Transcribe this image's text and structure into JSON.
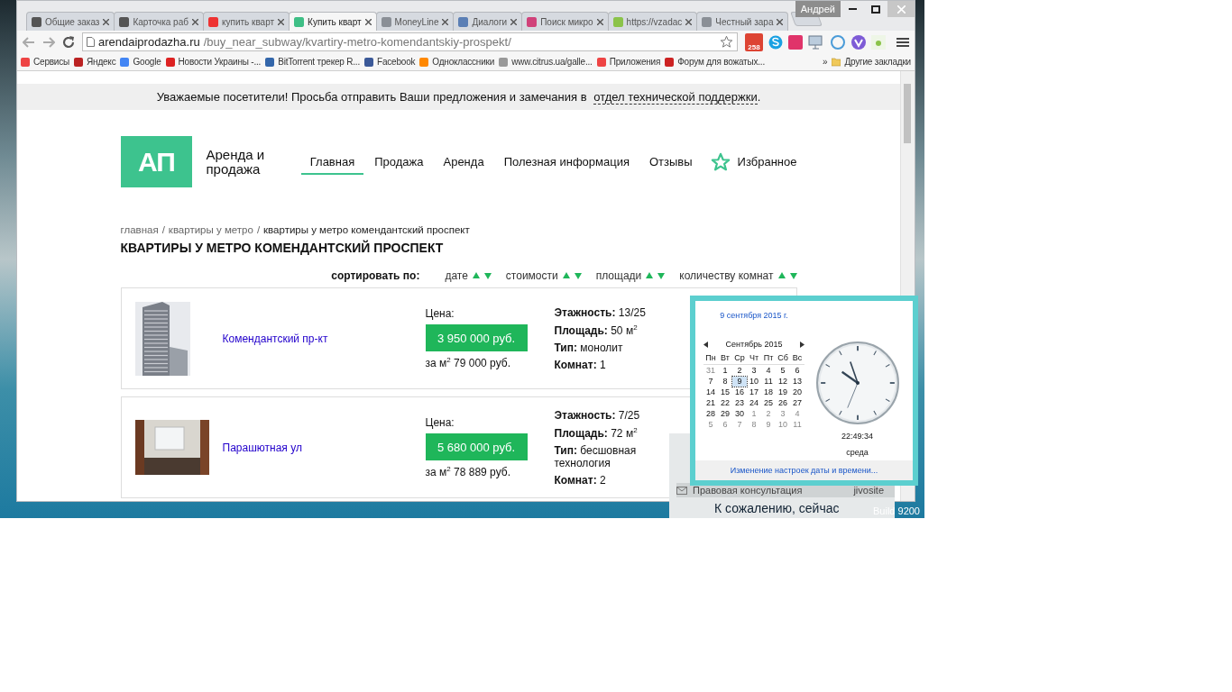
{
  "browser": {
    "tabs": [
      {
        "label": "Общие заказ",
        "selected": false
      },
      {
        "label": "Карточка раб",
        "selected": false
      },
      {
        "label": "купить кварт",
        "selected": false
      },
      {
        "label": "Купить кварт",
        "selected": true
      },
      {
        "label": "MoneyLine",
        "selected": false
      },
      {
        "label": "Диалоги",
        "selected": false
      },
      {
        "label": "Поиск микро",
        "selected": false
      },
      {
        "label": "https://vzadac",
        "selected": false
      },
      {
        "label": "Честный зара",
        "selected": false
      }
    ],
    "profile": "Андрей",
    "address": {
      "host": "arendaiprodazha.ru",
      "path": "/buy_near_subway/kvartiry-metro-komendantskiy-prospekt/"
    },
    "mail_badge": "258",
    "bookmarks": [
      "Сервисы",
      "Яндекс",
      "Google",
      "Новости Украины -...",
      "BitTorrent трекер R...",
      "Facebook",
      "Одноклассники",
      "www.citrus.ua/galle...",
      "Приложения",
      "Форум для вожатых..."
    ],
    "bookmarks_more": "»",
    "other_bookmarks": "Другие закладки"
  },
  "site": {
    "notice": {
      "text": "Уважаемые посетители! Просьба отправить Ваши предложения и замечания в ",
      "link": "отдел технической поддержки",
      "end": "."
    },
    "logo": {
      "mark": "АП",
      "name": "Аренда и продажа"
    },
    "nav": [
      {
        "label": "Главная",
        "selected": true
      },
      {
        "label": "Продажа",
        "selected": false
      },
      {
        "label": "Аренда",
        "selected": false
      },
      {
        "label": "Полезная информация",
        "selected": false
      },
      {
        "label": "Отзывы",
        "selected": false
      }
    ],
    "favorites": "Избранное",
    "breadcrumbs": [
      {
        "kind": "link",
        "text": "главная"
      },
      {
        "kind": "separator",
        "text": "/"
      },
      {
        "kind": "link",
        "text": "квартиры у метро"
      },
      {
        "kind": "separator",
        "text": "/"
      },
      {
        "kind": "current",
        "text": "квартиры у метро комендантский проспект"
      }
    ],
    "title": "КВАРТИРЫ У МЕТРО КОМЕНДАНТСКИЙ ПРОСПЕКТ",
    "sort": {
      "label": "сортировать по:",
      "options": [
        "дате",
        "стоимости",
        "площади",
        "количеству комнат"
      ]
    },
    "listings": [
      {
        "kind": "tower",
        "address": "Комендантский пр-кт",
        "price_label": "Цена:",
        "price": "3 950 000 руб.",
        "per_m2": "за м$^{2}$ 79 000 руб.",
        "details": [
          "**Этажность:** 13/25",
          "**Площадь:** 50 м$^{2}$",
          "**Тип:** монолит",
          "**Комнат:** 1"
        ]
      },
      {
        "kind": "room",
        "address": "Парашютная ул",
        "price_label": "Цена:",
        "price": "5 680 000 руб.",
        "per_m2": "за м$^{2}$ 78 889 руб.",
        "details": [
          "**Этажность:** 7/25",
          "**Площадь:** 72 м$^{2}$",
          "**Тип:** бесшовная технология",
          "**Комнат:** 2"
        ]
      }
    ]
  },
  "chat_widget": {
    "title": "Правовая консультация",
    "brand": "jivosite",
    "message": "К сожалению, сейчас"
  },
  "desktop": {
    "build": "Build 9200"
  },
  "calendar": {
    "date_link": "9 сентября 2015 г.",
    "month": "Сентябрь 2015",
    "weekdays": [
      "Пн",
      "Вт",
      "Ср",
      "Чт",
      "Пт",
      "Сб",
      "Вс"
    ],
    "weeks": [
      [
        {
          "d": "31",
          "other_month": true,
          "selected": false
        },
        {
          "d": "1",
          "other_month": false,
          "selected": false
        },
        {
          "d": "2",
          "other_month": false,
          "selected": false
        },
        {
          "d": "3",
          "other_month": false,
          "selected": false
        },
        {
          "d": "4",
          "other_month": false,
          "selected": false
        },
        {
          "d": "5",
          "other_month": false,
          "selected": false
        },
        {
          "d": "6",
          "other_month": false,
          "selected": false
        }
      ],
      [
        {
          "d": "7",
          "other_month": false,
          "selected": false
        },
        {
          "d": "8",
          "other_month": false,
          "selected": false
        },
        {
          "d": "9",
          "other_month": false,
          "selected": true
        },
        {
          "d": "10",
          "other_month": false,
          "selected": false
        },
        {
          "d": "11",
          "other_month": false,
          "selected": false
        },
        {
          "d": "12",
          "other_month": false,
          "selected": false
        },
        {
          "d": "13",
          "other_month": false,
          "selected": false
        }
      ],
      [
        {
          "d": "14",
          "other_month": false,
          "selected": false
        },
        {
          "d": "15",
          "other_month": false,
          "selected": false
        },
        {
          "d": "16",
          "other_month": false,
          "selected": false
        },
        {
          "d": "17",
          "other_month": false,
          "selected": false
        },
        {
          "d": "18",
          "other_month": false,
          "selected": false
        },
        {
          "d": "19",
          "other_month": false,
          "selected": false
        },
        {
          "d": "20",
          "other_month": false,
          "selected": false
        }
      ],
      [
        {
          "d": "21",
          "other_month": false,
          "selected": false
        },
        {
          "d": "22",
          "other_month": false,
          "selected": false
        },
        {
          "d": "23",
          "other_month": false,
          "selected": false
        },
        {
          "d": "24",
          "other_month": false,
          "selected": false
        },
        {
          "d": "25",
          "other_month": false,
          "selected": false
        },
        {
          "d": "26",
          "other_month": false,
          "selected": false
        },
        {
          "d": "27",
          "other_month": false,
          "selected": false
        }
      ],
      [
        {
          "d": "28",
          "other_month": false,
          "selected": false
        },
        {
          "d": "29",
          "other_month": false,
          "selected": false
        },
        {
          "d": "30",
          "other_month": false,
          "selected": false
        },
        {
          "d": "1",
          "other_month": true,
          "selected": false
        },
        {
          "d": "2",
          "other_month": true,
          "selected": false
        },
        {
          "d": "3",
          "other_month": true,
          "selected": false
        },
        {
          "d": "4",
          "other_month": true,
          "selected": false
        }
      ],
      [
        {
          "d": "5",
          "other_month": true,
          "selected": false
        },
        {
          "d": "6",
          "other_month": true,
          "selected": false
        },
        {
          "d": "7",
          "other_month": true,
          "selected": false
        },
        {
          "d": "8",
          "other_month": true,
          "selected": false
        },
        {
          "d": "9",
          "other_month": true,
          "selected": false
        },
        {
          "d": "10",
          "other_month": true,
          "selected": false
        },
        {
          "d": "11",
          "other_month": true,
          "selected": false
        }
      ]
    ],
    "time": "22:49:34",
    "weekday": "среда",
    "settings_link": "Изменение настроек даты и времени..."
  }
}
